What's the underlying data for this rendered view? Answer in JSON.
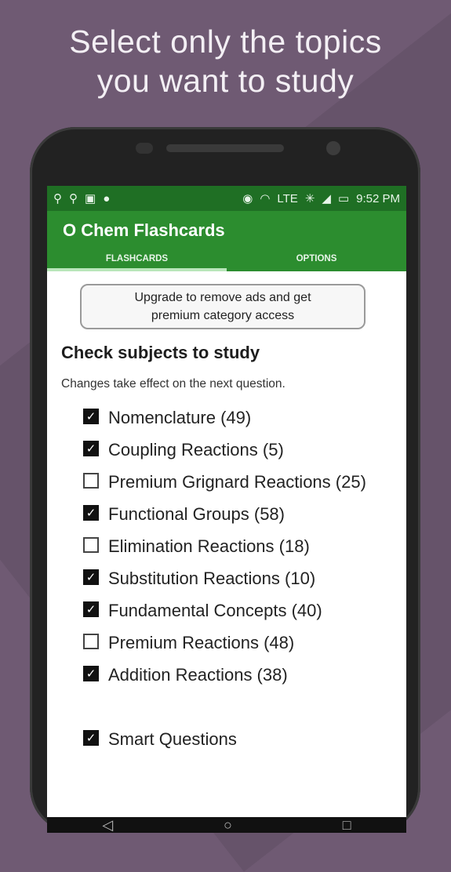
{
  "promo": {
    "line1": "Select only the topics",
    "line2": "you want to study"
  },
  "status": {
    "left_icons": [
      "usb-icon",
      "usb-icon",
      "image-icon",
      "android-icon"
    ],
    "right_icons": [
      "eye-icon",
      "wifi-icon",
      "lte-label",
      "bluetooth-icon",
      "signal-icon",
      "battery-icon"
    ],
    "lte": "LTE",
    "time": "9:52 PM"
  },
  "app": {
    "title": "O Chem Flashcards",
    "tabs": [
      {
        "label": "FLASHCARDS",
        "active": true
      },
      {
        "label": "OPTIONS",
        "active": false
      }
    ]
  },
  "upgrade": {
    "line1": "Upgrade to remove ads and get",
    "line2": "premium category access"
  },
  "subjects": {
    "heading": "Check subjects to study",
    "note": "Changes take effect on the next question.",
    "items": [
      {
        "label": "Nomenclature (49)",
        "checked": true
      },
      {
        "label": "Coupling Reactions (5)",
        "checked": true
      },
      {
        "label": "Premium Grignard Reactions (25)",
        "checked": false
      },
      {
        "label": "Functional Groups (58)",
        "checked": true
      },
      {
        "label": "Elimination Reactions (18)",
        "checked": false
      },
      {
        "label": "Substitution Reactions (10)",
        "checked": true
      },
      {
        "label": "Fundamental Concepts (40)",
        "checked": true
      },
      {
        "label": "Premium Reactions (48)",
        "checked": false
      },
      {
        "label": "Addition Reactions (38)",
        "checked": true
      }
    ],
    "smart": {
      "label": "Smart Questions",
      "checked": true
    }
  },
  "colors": {
    "background": "#6f5a73",
    "status_bar": "#1f6f24",
    "app_bar": "#2c8d2f"
  }
}
